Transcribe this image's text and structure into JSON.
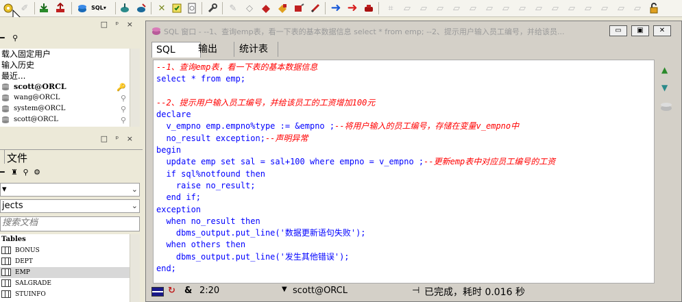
{
  "left_panel": {
    "history_items": [
      "载入固定用户",
      "输入历史",
      "最近..."
    ],
    "connections": [
      "scott@ORCL",
      "wang@ORCL",
      "system@ORCL",
      "scott@ORCL"
    ],
    "files_tab_label": "文件",
    "objects_combo": "jects",
    "search_placeholder": "搜索文档",
    "tables_header": "Tables",
    "tables": [
      "BONUS",
      "DEPT",
      "EMP",
      "SALGRADE",
      "STUINFO"
    ],
    "selected_table_index": 2
  },
  "sql_window": {
    "title": "SQL 窗口 - --1、查询emp表，看一下表的基本数据信息 select * from emp; --2、提示用户输入员工编号，并给该员...",
    "tabs": [
      "SQL",
      "输出",
      "统计表"
    ],
    "active_tab": "SQL",
    "code_lines": [
      [
        {
          "t": "--1、查询emp表，看一下表的基本数据信息",
          "c": "c"
        }
      ],
      [
        {
          "t": "select",
          "c": "k"
        },
        {
          "t": " * ",
          "c": "k"
        },
        {
          "t": "from",
          "c": "k"
        },
        {
          "t": " emp;",
          "c": "k"
        }
      ],
      [],
      [
        {
          "t": "--2、提示用户输入员工编号，并给该员工的工资增加100元",
          "c": "c"
        }
      ],
      [
        {
          "t": "declare",
          "c": "k"
        }
      ],
      [
        {
          "t": "  v_empno emp.empno%type := &empno ;",
          "c": "k"
        },
        {
          "t": "--将用户输入的员工编号，存储在变量v_empno中",
          "c": "c"
        }
      ],
      [
        {
          "t": "  no_result exception;",
          "c": "k"
        },
        {
          "t": "--声明异常",
          "c": "c"
        }
      ],
      [
        {
          "t": "begin",
          "c": "k"
        }
      ],
      [
        {
          "t": "  update emp set sal = sal+100 where empno = v_empno ;",
          "c": "k"
        },
        {
          "t": "--更新emp表中对应员工编号的工资",
          "c": "c"
        }
      ],
      [
        {
          "t": "  if sql%notfound then",
          "c": "k"
        }
      ],
      [
        {
          "t": "    raise no_result;",
          "c": "k"
        }
      ],
      [
        {
          "t": "  end if;",
          "c": "k"
        }
      ],
      [
        {
          "t": "exception",
          "c": "k"
        }
      ],
      [
        {
          "t": "  when no_result then",
          "c": "k"
        }
      ],
      [
        {
          "t": "    dbms_output.put_line('数据更新语句失败');",
          "c": "k"
        }
      ],
      [
        {
          "t": "  when others then",
          "c": "k"
        }
      ],
      [
        {
          "t": "    dbms_output.put_line('发生其他错误');",
          "c": "k"
        }
      ],
      [
        {
          "t": "end;",
          "c": "k"
        }
      ]
    ]
  },
  "status": {
    "position": "2:20",
    "connection": "scott@ORCL",
    "message": "已完成，耗时 0.016 秒"
  },
  "icons": [
    "settings-gear-icon",
    "wand-icon",
    "download-icon",
    "upload-icon",
    "run-sql-icon",
    "sql-dropdown-icon",
    "db-down-icon",
    "db-up-icon",
    "tools-icon",
    "note-icon",
    "doc-icon",
    "wrench-icon",
    "eraser-icon",
    "book-icon",
    "paint-icon",
    "camera-icon",
    "flag-icon",
    "arrow-right-blue-icon",
    "arrow-right-red-icon",
    "stop-icon",
    "lock-icon"
  ]
}
